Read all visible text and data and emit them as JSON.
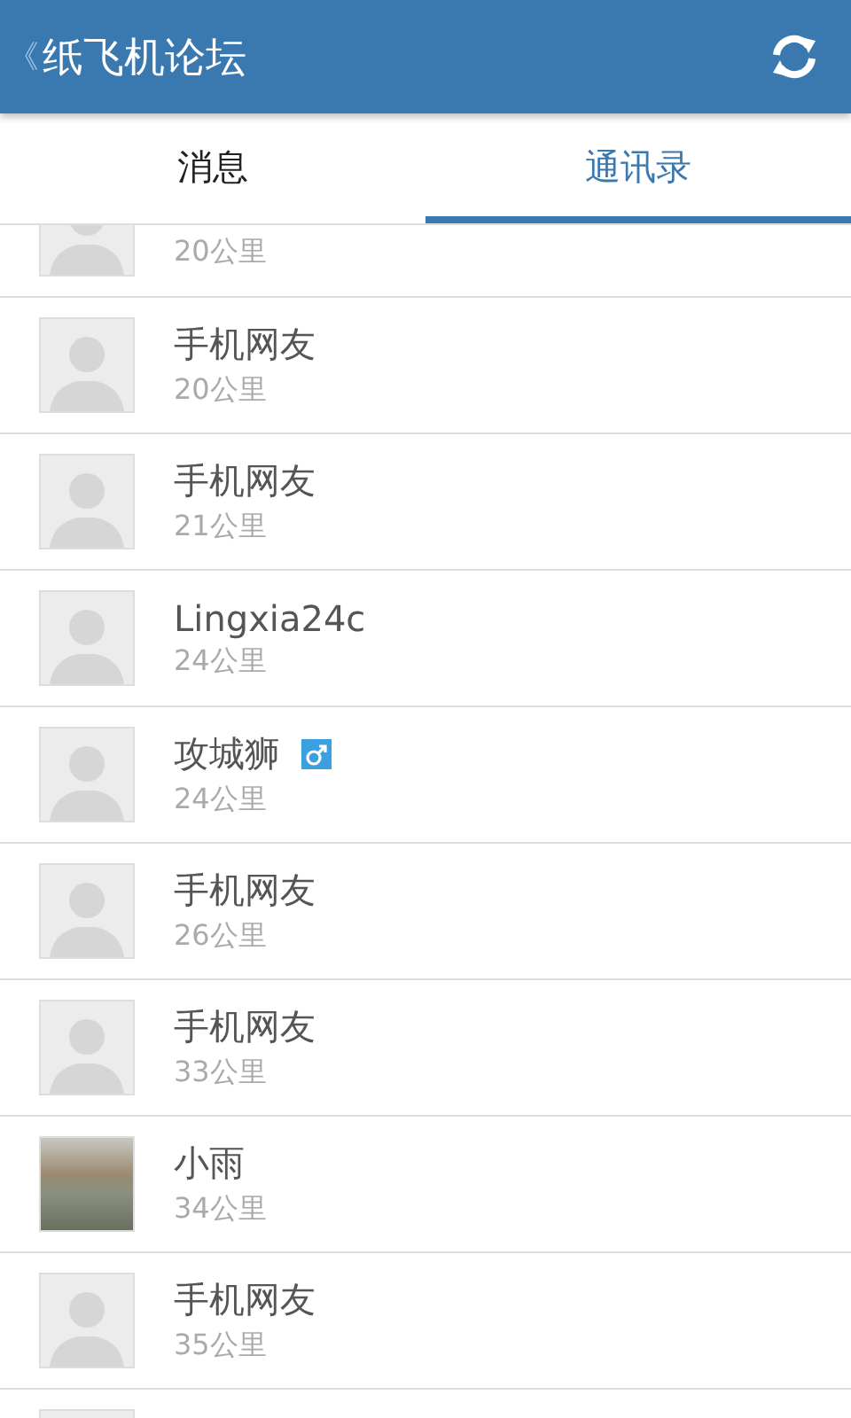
{
  "header": {
    "back": "《",
    "title": "纸飞机论坛"
  },
  "tabs": [
    {
      "label": "消息",
      "selected": false
    },
    {
      "label": "通讯录",
      "selected": true
    }
  ],
  "contacts": [
    {
      "photo": false,
      "distance": "20公里"
    },
    {
      "photo": false,
      "name": "手机网友",
      "distance": "20公里"
    },
    {
      "photo": false,
      "name": "手机网友",
      "distance": "21公里"
    },
    {
      "photo": false,
      "name": "Lingxia24c",
      "distance": "24公里"
    },
    {
      "photo": false,
      "name": "攻城狮",
      "male": true,
      "distance": "24公里"
    },
    {
      "photo": false,
      "name": "手机网友",
      "distance": "26公里"
    },
    {
      "photo": false,
      "name": "手机网友",
      "distance": "33公里"
    },
    {
      "photo": true,
      "name": "小雨",
      "distance": "34公里"
    },
    {
      "photo": false,
      "name": "手机网友",
      "distance": "35公里"
    },
    {
      "photo": false
    }
  ]
}
